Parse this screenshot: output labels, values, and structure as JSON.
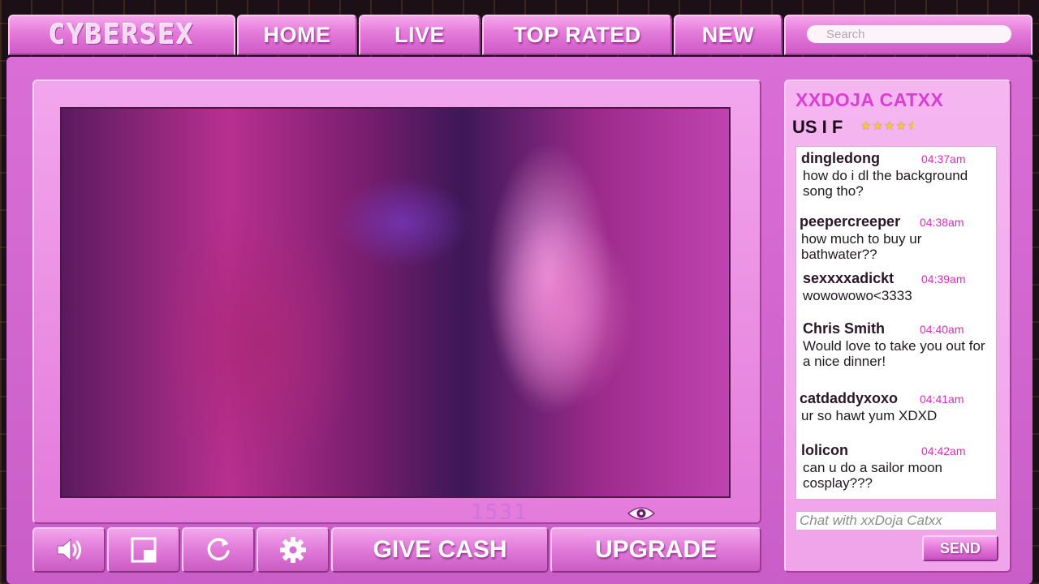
{
  "app": {
    "logo_text": "CYBERSEX"
  },
  "nav": {
    "items": [
      {
        "label": "HOME"
      },
      {
        "label": "LIVE"
      },
      {
        "label": "TOP RATED"
      },
      {
        "label": "NEW"
      }
    ],
    "search_placeholder": "Search"
  },
  "player": {
    "viewer_count": "1531",
    "controls": {
      "volume_icon": "speaker-icon",
      "fullscreen_icon": "fullscreen-icon",
      "refresh_icon": "refresh-icon",
      "settings_icon": "gear-icon"
    },
    "give_cash_label": "GIVE CASH",
    "upgrade_label": "UPGRADE"
  },
  "streamer": {
    "name": "XXDOJA CATXX",
    "meta": "US I F",
    "rating_stars": 4.5
  },
  "chat": {
    "messages": [
      {
        "user": "dingledong",
        "time": "04:37am",
        "text": "how do i dl the background song tho?"
      },
      {
        "user": "peepercreeper",
        "time": "04:38am",
        "text": "how much to buy ur bathwater??"
      },
      {
        "user": "sexxxxadickt",
        "time": "04:39am",
        "text": "wowowowo<3333"
      },
      {
        "user": "Chris Smith",
        "time": "04:40am",
        "text": "Would love to take you out for a nice dinner!"
      },
      {
        "user": "catdaddyxoxo",
        "time": "04:41am",
        "text": "ur so hawt yum XDXD"
      },
      {
        "user": "lolicon",
        "time": "04:42am",
        "text": "can u do a sailor moon cosplay???"
      }
    ],
    "input_placeholder": "Chat with xxDoja Catxx",
    "send_label": "SEND"
  },
  "colors": {
    "accent": "#e57ddb",
    "timestamp": "#d62fb7",
    "streamer_name": "#d83fd2",
    "star": "#f3c742"
  }
}
